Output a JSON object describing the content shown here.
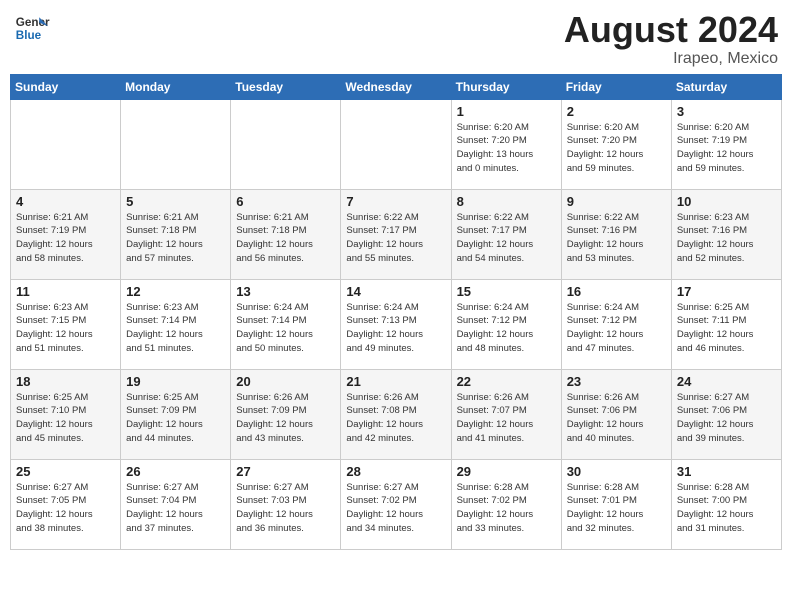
{
  "header": {
    "logo_line1": "General",
    "logo_line2": "Blue",
    "month_year": "August 2024",
    "location": "Irapeo, Mexico"
  },
  "days_of_week": [
    "Sunday",
    "Monday",
    "Tuesday",
    "Wednesday",
    "Thursday",
    "Friday",
    "Saturday"
  ],
  "weeks": [
    [
      {
        "day": "",
        "info": ""
      },
      {
        "day": "",
        "info": ""
      },
      {
        "day": "",
        "info": ""
      },
      {
        "day": "",
        "info": ""
      },
      {
        "day": "1",
        "info": "Sunrise: 6:20 AM\nSunset: 7:20 PM\nDaylight: 13 hours\nand 0 minutes."
      },
      {
        "day": "2",
        "info": "Sunrise: 6:20 AM\nSunset: 7:20 PM\nDaylight: 12 hours\nand 59 minutes."
      },
      {
        "day": "3",
        "info": "Sunrise: 6:20 AM\nSunset: 7:19 PM\nDaylight: 12 hours\nand 59 minutes."
      }
    ],
    [
      {
        "day": "4",
        "info": "Sunrise: 6:21 AM\nSunset: 7:19 PM\nDaylight: 12 hours\nand 58 minutes."
      },
      {
        "day": "5",
        "info": "Sunrise: 6:21 AM\nSunset: 7:18 PM\nDaylight: 12 hours\nand 57 minutes."
      },
      {
        "day": "6",
        "info": "Sunrise: 6:21 AM\nSunset: 7:18 PM\nDaylight: 12 hours\nand 56 minutes."
      },
      {
        "day": "7",
        "info": "Sunrise: 6:22 AM\nSunset: 7:17 PM\nDaylight: 12 hours\nand 55 minutes."
      },
      {
        "day": "8",
        "info": "Sunrise: 6:22 AM\nSunset: 7:17 PM\nDaylight: 12 hours\nand 54 minutes."
      },
      {
        "day": "9",
        "info": "Sunrise: 6:22 AM\nSunset: 7:16 PM\nDaylight: 12 hours\nand 53 minutes."
      },
      {
        "day": "10",
        "info": "Sunrise: 6:23 AM\nSunset: 7:16 PM\nDaylight: 12 hours\nand 52 minutes."
      }
    ],
    [
      {
        "day": "11",
        "info": "Sunrise: 6:23 AM\nSunset: 7:15 PM\nDaylight: 12 hours\nand 51 minutes."
      },
      {
        "day": "12",
        "info": "Sunrise: 6:23 AM\nSunset: 7:14 PM\nDaylight: 12 hours\nand 51 minutes."
      },
      {
        "day": "13",
        "info": "Sunrise: 6:24 AM\nSunset: 7:14 PM\nDaylight: 12 hours\nand 50 minutes."
      },
      {
        "day": "14",
        "info": "Sunrise: 6:24 AM\nSunset: 7:13 PM\nDaylight: 12 hours\nand 49 minutes."
      },
      {
        "day": "15",
        "info": "Sunrise: 6:24 AM\nSunset: 7:12 PM\nDaylight: 12 hours\nand 48 minutes."
      },
      {
        "day": "16",
        "info": "Sunrise: 6:24 AM\nSunset: 7:12 PM\nDaylight: 12 hours\nand 47 minutes."
      },
      {
        "day": "17",
        "info": "Sunrise: 6:25 AM\nSunset: 7:11 PM\nDaylight: 12 hours\nand 46 minutes."
      }
    ],
    [
      {
        "day": "18",
        "info": "Sunrise: 6:25 AM\nSunset: 7:10 PM\nDaylight: 12 hours\nand 45 minutes."
      },
      {
        "day": "19",
        "info": "Sunrise: 6:25 AM\nSunset: 7:09 PM\nDaylight: 12 hours\nand 44 minutes."
      },
      {
        "day": "20",
        "info": "Sunrise: 6:26 AM\nSunset: 7:09 PM\nDaylight: 12 hours\nand 43 minutes."
      },
      {
        "day": "21",
        "info": "Sunrise: 6:26 AM\nSunset: 7:08 PM\nDaylight: 12 hours\nand 42 minutes."
      },
      {
        "day": "22",
        "info": "Sunrise: 6:26 AM\nSunset: 7:07 PM\nDaylight: 12 hours\nand 41 minutes."
      },
      {
        "day": "23",
        "info": "Sunrise: 6:26 AM\nSunset: 7:06 PM\nDaylight: 12 hours\nand 40 minutes."
      },
      {
        "day": "24",
        "info": "Sunrise: 6:27 AM\nSunset: 7:06 PM\nDaylight: 12 hours\nand 39 minutes."
      }
    ],
    [
      {
        "day": "25",
        "info": "Sunrise: 6:27 AM\nSunset: 7:05 PM\nDaylight: 12 hours\nand 38 minutes."
      },
      {
        "day": "26",
        "info": "Sunrise: 6:27 AM\nSunset: 7:04 PM\nDaylight: 12 hours\nand 37 minutes."
      },
      {
        "day": "27",
        "info": "Sunrise: 6:27 AM\nSunset: 7:03 PM\nDaylight: 12 hours\nand 36 minutes."
      },
      {
        "day": "28",
        "info": "Sunrise: 6:27 AM\nSunset: 7:02 PM\nDaylight: 12 hours\nand 34 minutes."
      },
      {
        "day": "29",
        "info": "Sunrise: 6:28 AM\nSunset: 7:02 PM\nDaylight: 12 hours\nand 33 minutes."
      },
      {
        "day": "30",
        "info": "Sunrise: 6:28 AM\nSunset: 7:01 PM\nDaylight: 12 hours\nand 32 minutes."
      },
      {
        "day": "31",
        "info": "Sunrise: 6:28 AM\nSunset: 7:00 PM\nDaylight: 12 hours\nand 31 minutes."
      }
    ]
  ]
}
